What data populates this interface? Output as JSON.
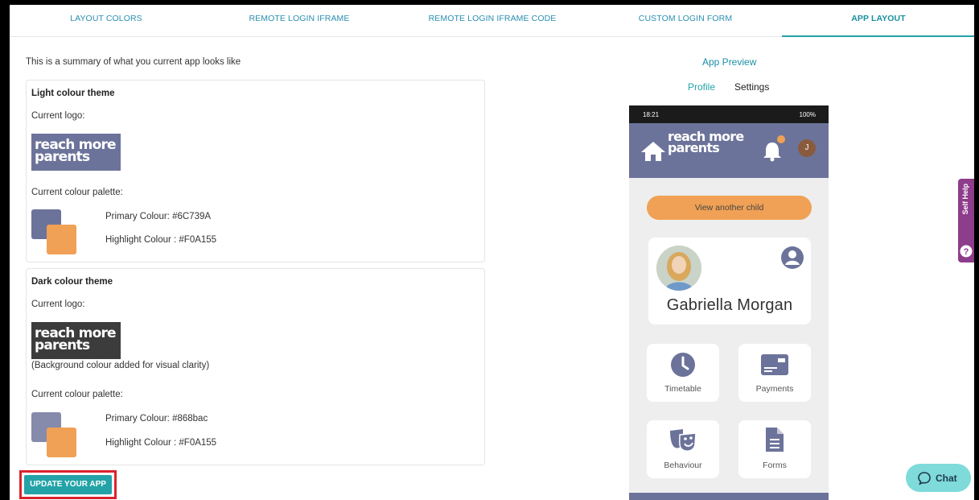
{
  "tabs": [
    {
      "label": "LAYOUT COLORS"
    },
    {
      "label": "REMOTE LOGIN IFRAME"
    },
    {
      "label": "REMOTE LOGIN IFRAME CODE"
    },
    {
      "label": "CUSTOM LOGIN FORM"
    },
    {
      "label": "APP LAYOUT",
      "active": true
    }
  ],
  "summary_text": "This is a summary of what you current app looks like",
  "light_theme": {
    "title": "Light colour theme",
    "logo_label": "Current logo:",
    "logo_line1": "reach more",
    "logo_line2": "parents",
    "palette_label": "Current colour palette:",
    "primary_text": "Primary Colour: #6C739A",
    "highlight_text": "Highlight Colour : #F0A155",
    "primary_color": "#6C739A",
    "highlight_color": "#F0A155"
  },
  "dark_theme": {
    "title": "Dark colour theme",
    "logo_label": "Current logo:",
    "logo_line1": "reach more",
    "logo_line2": "parents",
    "logo_note": "(Background colour added for visual clarity)",
    "palette_label": "Current colour palette:",
    "primary_text": "Primary Colour: #868bac",
    "highlight_text": "Highlight Colour : #F0A155",
    "primary_color": "#868bac",
    "highlight_color": "#F0A155"
  },
  "update_button": "UPDATE YOUR APP",
  "preview": {
    "title": "App Preview",
    "tab_profile": "Profile",
    "tab_settings": "Settings",
    "status_time": "18:21",
    "status_right": "100%",
    "header_logo_line1": "reach more",
    "header_logo_line2": "parents",
    "avatar_initial": "J",
    "view_child": "View another child",
    "child_name": "Gabriella Morgan",
    "tiles": [
      {
        "label": "Timetable",
        "icon": "clock-icon"
      },
      {
        "label": "Payments",
        "icon": "payment-card-icon"
      },
      {
        "label": "Behaviour",
        "icon": "masks-icon"
      },
      {
        "label": "Forms",
        "icon": "document-icon"
      }
    ]
  },
  "self_help": "Self Help",
  "chat": "Chat"
}
